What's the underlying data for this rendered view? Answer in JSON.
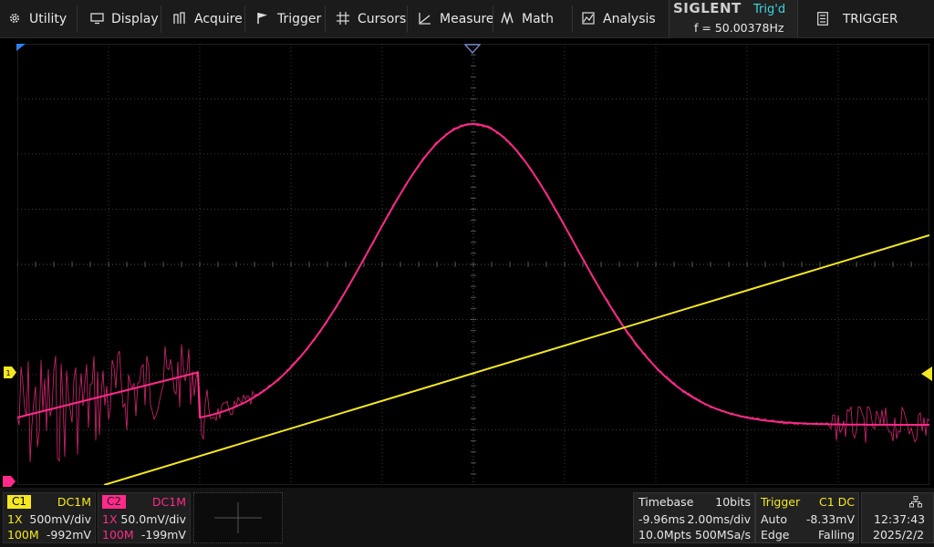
{
  "menu": {
    "items": [
      {
        "label": "Utility",
        "icon": "gear-icon"
      },
      {
        "label": "Display",
        "icon": "monitor-icon"
      },
      {
        "label": "Acquire",
        "icon": "acquire-icon"
      },
      {
        "label": "Trigger",
        "icon": "flag-icon"
      },
      {
        "label": "Cursors",
        "icon": "crosshair-icon"
      },
      {
        "label": "Measure",
        "icon": "measure-icon"
      },
      {
        "label": "Math",
        "icon": "math-icon"
      },
      {
        "label": "Analysis",
        "icon": "analysis-icon"
      }
    ]
  },
  "header": {
    "brand": "SIGLENT",
    "trig_status": "Trig'd",
    "frequency": "f = 50.00378Hz",
    "panel_button": "TRIGGER"
  },
  "channels": [
    {
      "name": "C1",
      "coupling": "DC1M",
      "probe": "1X",
      "scale": "500mV/div",
      "bandwidth": "100M",
      "offset": "-992mV",
      "color": "#f5e81e"
    },
    {
      "name": "C2",
      "coupling": "DC1M",
      "probe": "1X",
      "scale": "50.0mV/div",
      "bandwidth": "100M",
      "offset": "-199mV",
      "color": "#ff2a8a"
    }
  ],
  "timebase": {
    "label": "Timebase",
    "bits": "10bits",
    "delay": "-9.96ms",
    "scale": "2.00ms/div",
    "memory": "10.0Mpts",
    "sample_rate": "500MSa/s"
  },
  "trigger": {
    "label": "Trigger",
    "source": "C1 DC",
    "mode": "Auto",
    "level": "-8.33mV",
    "type": "Edge",
    "slope": "Falling"
  },
  "clock": {
    "time": "12:37:43",
    "date": "2025/2/2"
  },
  "colors": {
    "ch1": "#f5e81e",
    "ch2": "#ff2a8a",
    "accent": "#3fd6e0"
  }
}
